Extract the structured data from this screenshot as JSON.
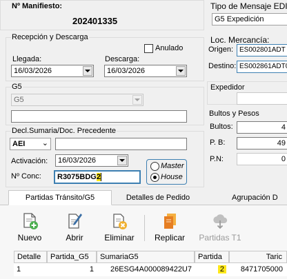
{
  "manifest": {
    "label": "Nº Manifiesto:",
    "number": "202401335"
  },
  "reception": {
    "title": "Recepción y Descarga",
    "anulado_label": "Anulado",
    "llegada_label": "Llegada:",
    "llegada_value": "16/03/2026",
    "descarga_label": "Descarga:",
    "descarga_value": "16/03/2026"
  },
  "g5": {
    "title": "G5",
    "select_value": "G5",
    "text_value": ""
  },
  "decl": {
    "title": "Decl.Sumaria/Doc. Precedente",
    "type_value": "AEI",
    "activation_label": "Activación:",
    "activation_value": "16/03/2026",
    "conc_label": "Nº Conc:",
    "conc_prefix": "R3075BDG",
    "conc_highlight": "2",
    "radio_master": "Master",
    "radio_house": "House"
  },
  "right": {
    "edi_title": "Tipo de Mensaje EDI",
    "edi_value": "G5 Expedición",
    "loc_title": "Loc. Mercancía:",
    "origen_label": "Origen:",
    "origen_value": "ES002801ADT",
    "destino_label": "Destino:",
    "destino_value": "ES002861ADT0",
    "expedidor_label": "Expedidor",
    "bultos_title": "Bultos y Pesos",
    "bultos_label": "Bultos:",
    "bultos_value": "4",
    "pb_label": "P. B:",
    "pb_value": "49",
    "pn_label": "P.N:",
    "pn_value": "0"
  },
  "tabs": [
    {
      "label": "Partidas Tránsito/G5"
    },
    {
      "label": "Detalles de Pedido"
    },
    {
      "label": "Agrupación D"
    }
  ],
  "toolbar": [
    {
      "label": "Nuevo",
      "icon": "new-doc-icon"
    },
    {
      "label": "Abrir",
      "icon": "edit-doc-icon"
    },
    {
      "label": "Eliminar",
      "icon": "delete-doc-icon"
    },
    {
      "label": "Replicar",
      "icon": "replicate-icon"
    },
    {
      "label": "Partidas T1",
      "icon": "cloud-download-icon"
    }
  ],
  "grid": {
    "headers": [
      "Detalle",
      "Partida_G5",
      "SumariaG5",
      "Partida",
      "Taric"
    ],
    "row": {
      "detalle": "1",
      "partida_g5": "1",
      "sumaria": "26ESG4A000089422U7",
      "partida": "2",
      "taric": "8471705000"
    }
  },
  "colors": {
    "highlight": "#ffe81a",
    "accent_orange": "#f39c12",
    "icon_blue": "#3a6ea5",
    "delete_red": "#d9302c"
  }
}
